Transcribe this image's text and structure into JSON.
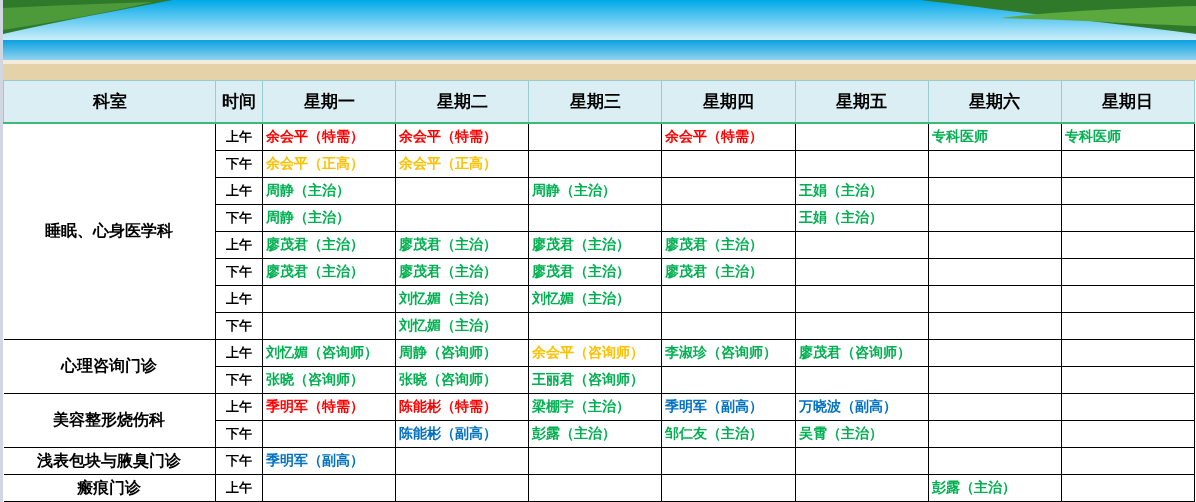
{
  "table": {
    "columns": [
      "科室",
      "时间",
      "星期一",
      "星期二",
      "星期三",
      "星期四",
      "星期五",
      "星期六",
      "星期日"
    ],
    "departments": [
      {
        "name": "睡眠、心身医学科",
        "slots": [
          {
            "time": "上午",
            "cells": [
              {
                "text": "余会平（特需）",
                "color": "#ff0000"
              },
              {
                "text": "余会平（特需）",
                "color": "#ff0000"
              },
              null,
              {
                "text": "余会平（特需）",
                "color": "#ff0000"
              },
              null,
              {
                "text": "专科医师",
                "color": "#00b050"
              },
              {
                "text": "专科医师",
                "color": "#00b050"
              }
            ]
          },
          {
            "time": "下午",
            "cells": [
              {
                "text": "余会平（正高）",
                "color": "#ffc000"
              },
              {
                "text": "余会平（正高）",
                "color": "#ffc000"
              },
              null,
              null,
              null,
              null,
              null
            ]
          },
          {
            "time": "上午",
            "cells": [
              {
                "text": "周静（主治）",
                "color": "#00b050"
              },
              null,
              {
                "text": "周静（主治）",
                "color": "#00b050"
              },
              null,
              {
                "text": "王娟（主治）",
                "color": "#00b050"
              },
              null,
              null
            ]
          },
          {
            "time": "下午",
            "cells": [
              {
                "text": "周静（主治）",
                "color": "#00b050"
              },
              null,
              null,
              null,
              {
                "text": "王娟（主治）",
                "color": "#00b050"
              },
              null,
              null
            ]
          },
          {
            "time": "上午",
            "cells": [
              {
                "text": "廖茂君（主治）",
                "color": "#00b050"
              },
              {
                "text": "廖茂君（主治）",
                "color": "#00b050"
              },
              {
                "text": "廖茂君（主治）",
                "color": "#00b050"
              },
              {
                "text": "廖茂君（主治）",
                "color": "#00b050"
              },
              null,
              null,
              null
            ]
          },
          {
            "time": "下午",
            "cells": [
              {
                "text": "廖茂君（主治）",
                "color": "#00b050"
              },
              {
                "text": "廖茂君（主治）",
                "color": "#00b050"
              },
              {
                "text": "廖茂君（主治）",
                "color": "#00b050"
              },
              {
                "text": "廖茂君（主治）",
                "color": "#00b050"
              },
              null,
              null,
              null
            ]
          },
          {
            "time": "上午",
            "cells": [
              null,
              {
                "text": "刘忆媚（主治）",
                "color": "#00b050"
              },
              {
                "text": "刘忆媚（主治）",
                "color": "#00b050"
              },
              null,
              null,
              null,
              null
            ]
          },
          {
            "time": "下午",
            "cells": [
              null,
              {
                "text": "刘忆媚（主治）",
                "color": "#00b050"
              },
              null,
              null,
              null,
              null,
              null
            ]
          }
        ]
      },
      {
        "name": "心理咨询门诊",
        "slots": [
          {
            "time": "上午",
            "cells": [
              {
                "text": "刘忆媚（咨询师）",
                "color": "#00b050"
              },
              {
                "text": "周静（咨询师）",
                "color": "#00b050"
              },
              {
                "text": "余会平（咨询师）",
                "color": "#ffc000"
              },
              {
                "text": "李淑珍（咨询师）",
                "color": "#00b050"
              },
              {
                "text": "廖茂君（咨询师）",
                "color": "#00b050"
              },
              null,
              null
            ]
          },
          {
            "time": "下午",
            "cells": [
              {
                "text": "张晓（咨询师）",
                "color": "#00b050"
              },
              {
                "text": "张晓（咨询师）",
                "color": "#00b050"
              },
              {
                "text": "王丽君（咨询师）",
                "color": "#00b050"
              },
              null,
              null,
              null,
              null
            ]
          }
        ]
      },
      {
        "name": "美容整形烧伤科",
        "slots": [
          {
            "time": "上午",
            "cells": [
              {
                "text": "季明军（特需）",
                "color": "#ff0000"
              },
              {
                "text": "陈能彬（特需）",
                "color": "#ff0000"
              },
              {
                "text": "梁棚宇（主治）",
                "color": "#00b050"
              },
              {
                "text": "季明军（副高）",
                "color": "#0070c0"
              },
              {
                "text": "万晓波（副高）",
                "color": "#0070c0"
              },
              null,
              null
            ]
          },
          {
            "time": "下午",
            "cells": [
              null,
              {
                "text": "陈能彬（副高）",
                "color": "#0070c0"
              },
              {
                "text": "彭露（主治）",
                "color": "#00b050"
              },
              {
                "text": "邹仁友（主治）",
                "color": "#00b050"
              },
              {
                "text": "吴霄（主治）",
                "color": "#00b050"
              },
              null,
              null
            ]
          }
        ]
      },
      {
        "name": "浅表包块与腋臭门诊",
        "slots": [
          {
            "time": "下午",
            "cells": [
              {
                "text": "季明军（副高）",
                "color": "#0070c0"
              },
              null,
              null,
              null,
              null,
              null,
              null
            ]
          }
        ]
      },
      {
        "name": "瘢痕门诊",
        "slots": [
          {
            "time": "上午",
            "cells": [
              null,
              null,
              null,
              null,
              null,
              {
                "text": "彭露（主治）",
                "color": "#00b050"
              },
              null
            ]
          }
        ]
      }
    ]
  }
}
